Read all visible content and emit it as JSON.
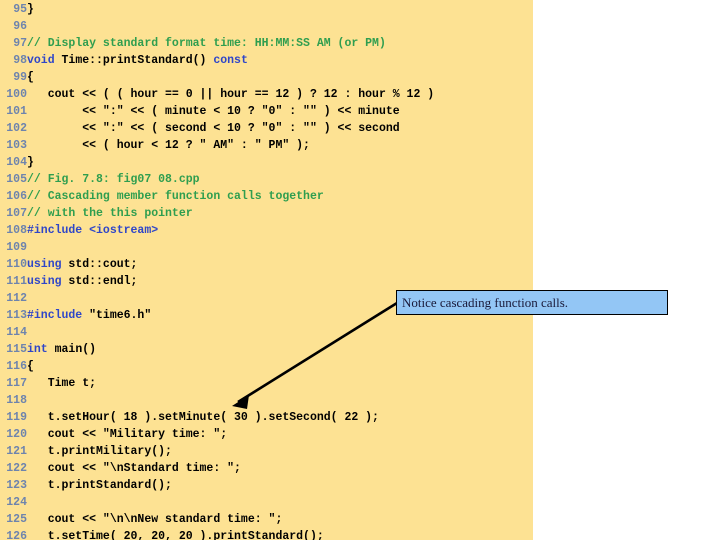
{
  "slide": {
    "background_color": "#ffffff",
    "code_panel_color": "#fde293"
  },
  "colors": {
    "line_number": "#6e84ad",
    "code_default": "#000000",
    "keyword": "#2f46c8",
    "comment": "#2f9e4f",
    "preprocessor": "#2f46c8",
    "callout_fill": "#93c6f5",
    "callout_border": "#000000",
    "arrow": "#000000"
  },
  "code": {
    "language": "cpp",
    "first_line_number": 95,
    "last_line_number": 126,
    "lines": [
      {
        "no": "95",
        "text": "}"
      },
      {
        "no": "96",
        "text": ""
      },
      {
        "no": "97",
        "text": "// Display standard format time: HH:MM:SS AM (or PM)"
      },
      {
        "no": "98",
        "text": "void Time::printStandard() const"
      },
      {
        "no": "99",
        "text": "{"
      },
      {
        "no": "100",
        "text": "   cout << ( ( hour == 0 || hour == 12 ) ? 12 : hour % 12 )"
      },
      {
        "no": "101",
        "text": "        << \":\" << ( minute < 10 ? \"0\" : \"\" ) << minute"
      },
      {
        "no": "102",
        "text": "        << \":\" << ( second < 10 ? \"0\" : \"\" ) << second"
      },
      {
        "no": "103",
        "text": "        << ( hour < 12 ? \" AM\" : \" PM\" );"
      },
      {
        "no": "104",
        "text": "}"
      },
      {
        "no": "105",
        "text": "// Fig. 7.8: fig07 08.cpp"
      },
      {
        "no": "106",
        "text": "// Cascading member function calls together"
      },
      {
        "no": "107",
        "text": "// with the this pointer"
      },
      {
        "no": "108",
        "text": "#include <iostream>"
      },
      {
        "no": "109",
        "text": ""
      },
      {
        "no": "110",
        "text": "using std::cout;"
      },
      {
        "no": "111",
        "text": "using std::endl;"
      },
      {
        "no": "112",
        "text": ""
      },
      {
        "no": "113",
        "text": "#include \"time6.h\""
      },
      {
        "no": "114",
        "text": ""
      },
      {
        "no": "115",
        "text": "int main()"
      },
      {
        "no": "116",
        "text": "{"
      },
      {
        "no": "117",
        "text": "   Time t;"
      },
      {
        "no": "118",
        "text": ""
      },
      {
        "no": "119",
        "text": "   t.setHour( 18 ).setMinute( 30 ).setSecond( 22 );"
      },
      {
        "no": "120",
        "text": "   cout << \"Military time: \";"
      },
      {
        "no": "121",
        "text": "   t.printMilitary();"
      },
      {
        "no": "122",
        "text": "   cout << \"\\nStandard time: \";"
      },
      {
        "no": "123",
        "text": "   t.printStandard();"
      },
      {
        "no": "124",
        "text": ""
      },
      {
        "no": "125",
        "text": "   cout << \"\\n\\nNew standard time: \";"
      },
      {
        "no": "126",
        "text": "   t.setTime( 20, 20, 20 ).printStandard();"
      }
    ],
    "tokens": [
      {
        "line": "97",
        "spans": [
          {
            "t": "// Display standard format time: HH:MM:SS AM (or PM)",
            "c": "com"
          }
        ]
      },
      {
        "line": "98",
        "spans": [
          {
            "t": "void",
            "c": "kw"
          },
          {
            "t": " Time::printStandard() ",
            "c": "def"
          },
          {
            "t": "const",
            "c": "kw"
          }
        ]
      },
      {
        "line": "105",
        "spans": [
          {
            "t": "// Fig. 7.8: fig07 08.cpp",
            "c": "com"
          }
        ]
      },
      {
        "line": "106",
        "spans": [
          {
            "t": "// Cascading member function calls together",
            "c": "com"
          }
        ]
      },
      {
        "line": "107",
        "spans": [
          {
            "t": "// with the this pointer",
            "c": "com"
          }
        ]
      },
      {
        "line": "108",
        "spans": [
          {
            "t": "#include <iostream>",
            "c": "pre"
          }
        ]
      },
      {
        "line": "110",
        "spans": [
          {
            "t": "using",
            "c": "kw"
          },
          {
            "t": " std::cout;",
            "c": "def"
          }
        ]
      },
      {
        "line": "111",
        "spans": [
          {
            "t": "using",
            "c": "kw"
          },
          {
            "t": " std::endl;",
            "c": "def"
          }
        ]
      },
      {
        "line": "113",
        "spans": [
          {
            "t": "#include",
            "c": "pre"
          },
          {
            "t": " \"time6.h\"",
            "c": "def"
          }
        ]
      },
      {
        "line": "115",
        "spans": [
          {
            "t": "int",
            "c": "kw"
          },
          {
            "t": " main()",
            "c": "def"
          }
        ]
      }
    ]
  },
  "callout": {
    "text": "Notice cascading function calls.",
    "points_to_line": "119"
  }
}
